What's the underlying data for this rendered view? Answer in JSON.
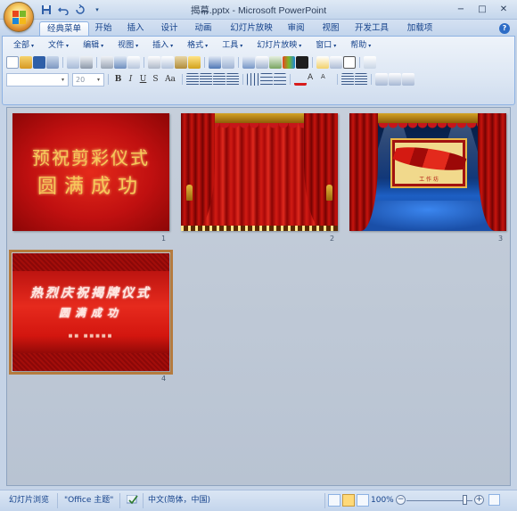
{
  "window": {
    "title": "揭幕.pptx - Microsoft PowerPoint",
    "controls": {
      "minimize": "−",
      "maximize": "□",
      "close": "✕"
    }
  },
  "quick_access": [
    "save-icon",
    "undo-icon",
    "redo-icon"
  ],
  "ribbon_tabs": [
    {
      "label": "经典菜单",
      "active": true
    },
    {
      "label": "开始"
    },
    {
      "label": "插入"
    },
    {
      "label": "设计"
    },
    {
      "label": "动画"
    },
    {
      "label": "幻灯片放映"
    },
    {
      "label": "审阅"
    },
    {
      "label": "视图"
    },
    {
      "label": "开发工具"
    },
    {
      "label": "加载项"
    }
  ],
  "classic_menu": [
    "全部",
    "文件",
    "编辑",
    "视图",
    "插入",
    "格式",
    "工具",
    "幻灯片放映",
    "窗口",
    "帮助"
  ],
  "format_bar": {
    "font_size": "20",
    "buttons": [
      "B",
      "I",
      "U",
      "S",
      "Aa"
    ]
  },
  "slides": [
    {
      "number": "1",
      "line1": "预祝剪彩仪式",
      "line2": "圆满成功"
    },
    {
      "number": "2"
    },
    {
      "number": "3",
      "board_text": "工 作 坊"
    },
    {
      "number": "4",
      "line1": "热烈庆祝揭牌仪式",
      "line2": "圆满成功",
      "subline": "■■ ■■■■■",
      "selected": true
    }
  ],
  "status": {
    "view": "幻灯片浏览",
    "theme": "\"Office 主题\"",
    "language": "中文(简体，中国)",
    "zoom": "100%",
    "zoom_minus": "−",
    "zoom_plus": "+"
  }
}
